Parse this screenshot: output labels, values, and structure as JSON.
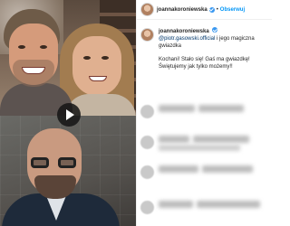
{
  "header": {
    "username": "joannakoroniewska",
    "separator": "•",
    "follow_label": "Obserwuj"
  },
  "caption": {
    "username": "joannakoroniewska",
    "mention": "@piotr.gasowski.official",
    "line1_rest": " i jego magiczna gwiazdka",
    "paragraph2": "Kochani! Stało się! Gaś ma gwiazdkę! Świętujemy jak tylko możemy!!"
  },
  "media": {
    "play_icon": "play-icon"
  },
  "colors": {
    "follow": "#0095f6",
    "verified": "#3897f0",
    "mention": "#00376b"
  }
}
